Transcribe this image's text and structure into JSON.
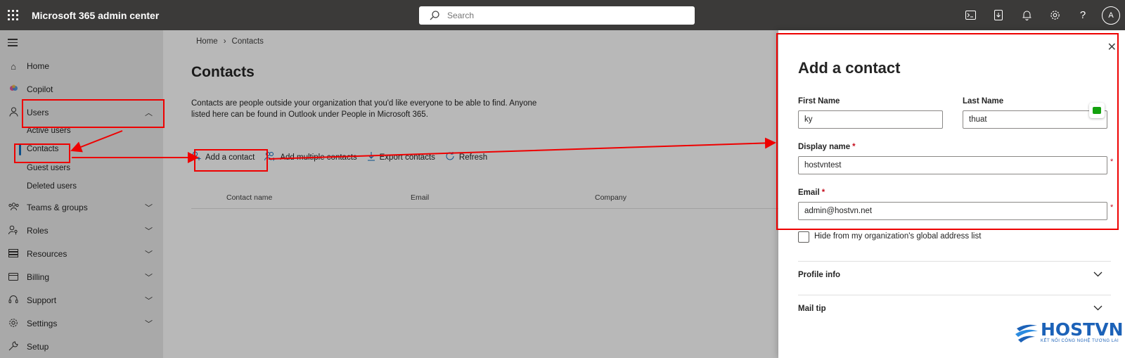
{
  "topbar": {
    "app_title": "Microsoft 365 admin center",
    "search_placeholder": "Search",
    "avatar_initial": "A",
    "icons": [
      "terminal-icon",
      "mobile-download-icon",
      "bell-icon",
      "gear-icon",
      "help-icon"
    ]
  },
  "sidebar": {
    "items": [
      {
        "label": "Home",
        "icon": "home-icon"
      },
      {
        "label": "Copilot",
        "icon": "copilot-icon"
      },
      {
        "label": "Users",
        "icon": "person-icon"
      },
      {
        "label": "Teams & groups",
        "icon": "people-team-icon"
      },
      {
        "label": "Roles",
        "icon": "person-key-icon"
      },
      {
        "label": "Resources",
        "icon": "resources-icon"
      },
      {
        "label": "Billing",
        "icon": "billing-icon"
      },
      {
        "label": "Support",
        "icon": "headset-icon"
      },
      {
        "label": "Settings",
        "icon": "gear-icon"
      },
      {
        "label": "Setup",
        "icon": "wrench-icon"
      }
    ],
    "users_sub": [
      "Active users",
      "Contacts",
      "Guest users",
      "Deleted users"
    ]
  },
  "main": {
    "breadcrumb": [
      "Home",
      "Contacts"
    ],
    "title": "Contacts",
    "description": "Contacts are people outside your organization that you'd like everyone to be able to find. Anyone listed here can be found in Outlook under People in Microsoft 365.",
    "commands": [
      "Add a contact",
      "Add multiple contacts",
      "Export contacts",
      "Refresh"
    ],
    "columns": [
      "Contact name",
      "Email",
      "Company"
    ]
  },
  "panel": {
    "title": "Add a contact",
    "first_name_label": "First Name",
    "first_name_value": "ky",
    "last_name_label": "Last Name",
    "last_name_value": "thuat",
    "display_name_label": "Display name",
    "display_name_value": "hostvntest",
    "email_label": "Email",
    "email_value": "admin@hostvn.net",
    "required_marker": "*",
    "hide_label": "Hide from my organization's global address list",
    "sections": [
      "Profile info",
      "Mail tip"
    ]
  },
  "logo": {
    "name": "HOSTVN",
    "tagline": "KẾT NỐI CÔNG NGHỆ TƯƠNG LAI"
  },
  "colors": {
    "topbar": "#3b3a39",
    "sidebar": "#ebebeb",
    "accent": "#0f6cbd",
    "annotation": "#ee0000",
    "required": "#c50f1f"
  }
}
